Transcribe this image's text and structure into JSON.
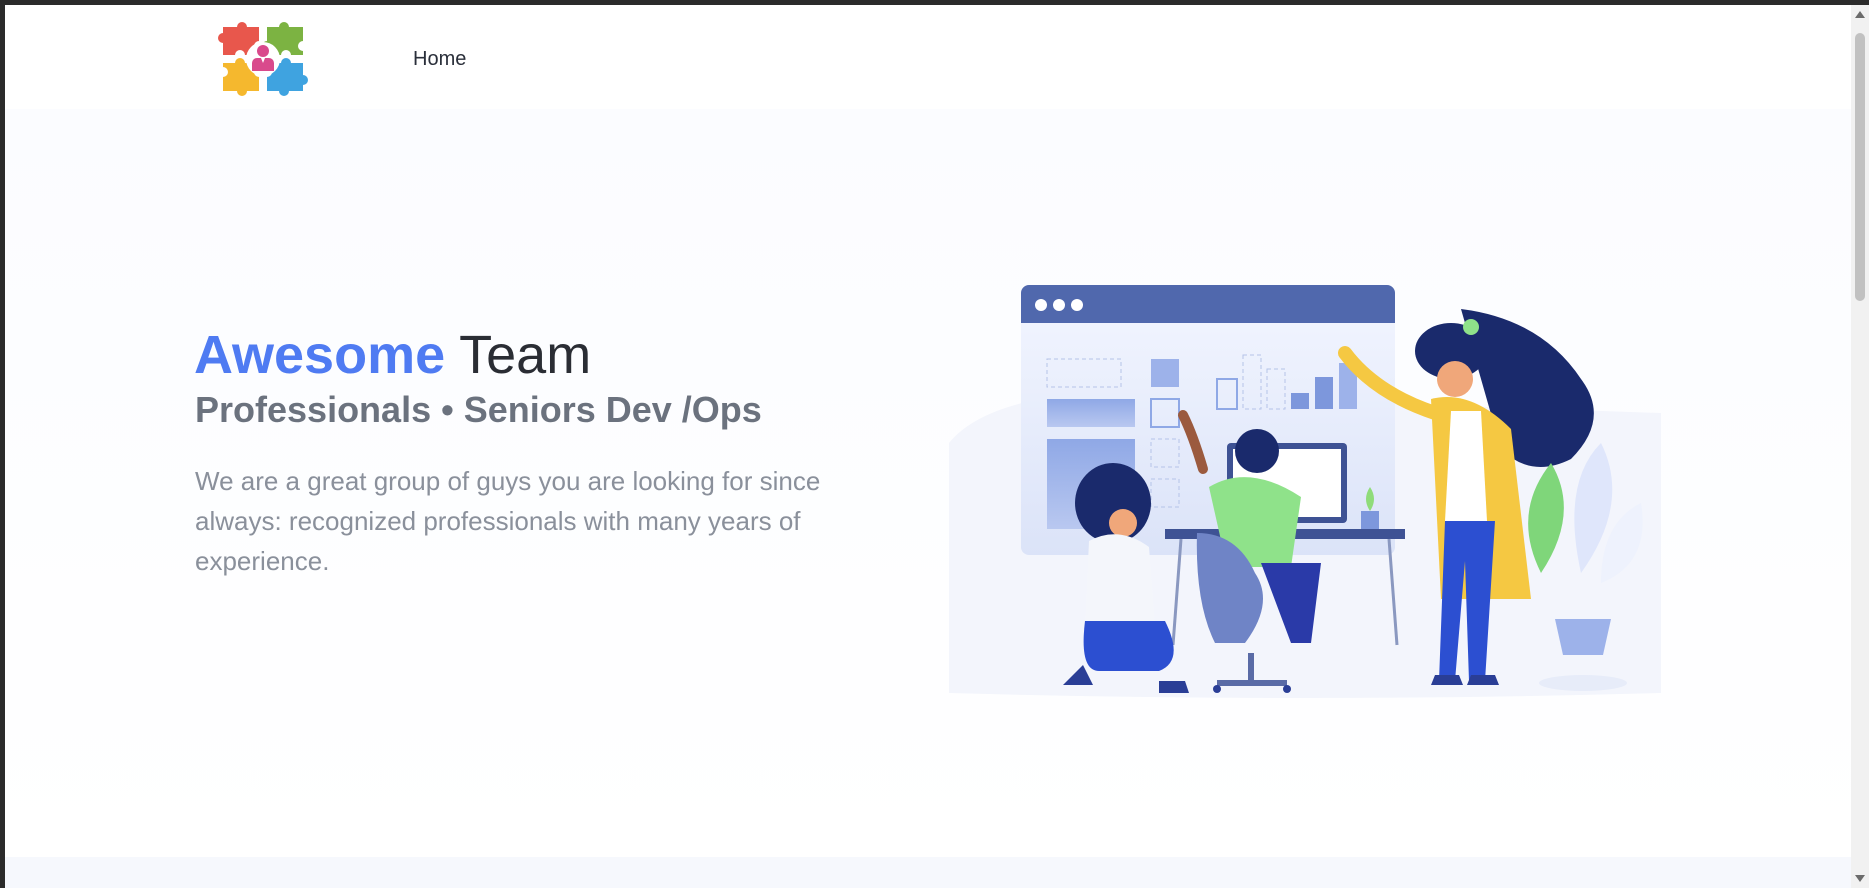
{
  "nav": {
    "logo_icon": "puzzle-team-logo-icon",
    "home_label": "Home"
  },
  "hero": {
    "title_accent": "Awesome",
    "title_rest": " Team",
    "subtitle": "Professionals • Seniors Dev /Ops",
    "description": "We are a great group of guys you are looking for since always: recognized professionals with many years of experience.",
    "illustration_icon": "team-dashboard-illustration"
  },
  "colors": {
    "accent": "#4f7bf2",
    "heading": "#2a2d34",
    "subheading": "#6b727e",
    "body_text": "#8a909b"
  }
}
